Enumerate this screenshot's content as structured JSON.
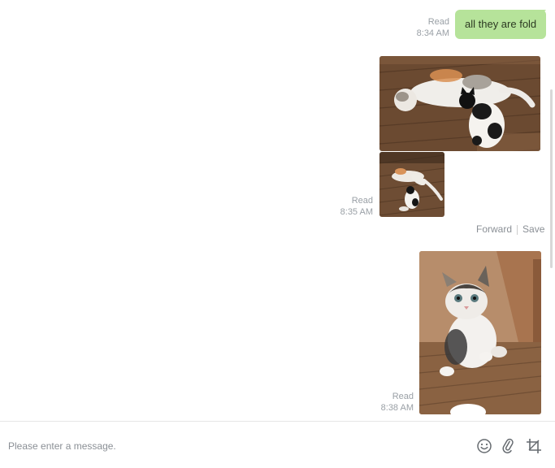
{
  "messages": {
    "text_message": {
      "text": "all they are fold",
      "status": "Read",
      "time": "8:34 AM"
    },
    "photo_group": {
      "status": "Read",
      "time": "8:35 AM",
      "photos": [
        {
          "description": "calico cat lying with black-and-white kitten on wooden floor"
        },
        {
          "description": "cats on wooden floor thumbnail"
        }
      ],
      "actions": {
        "forward_label": "Forward",
        "save_label": "Save"
      }
    },
    "photo_single": {
      "status": "Read",
      "time": "8:38 AM",
      "photos": [
        {
          "description": "white and tabby kitten sitting on wooden floor"
        }
      ]
    }
  },
  "composer": {
    "placeholder": "Please enter a message.",
    "icons": [
      "smiley-icon",
      "paperclip-icon",
      "crop-icon"
    ]
  },
  "colors": {
    "bubble": "#b6e39a",
    "meta_text": "#9aa0a6",
    "icon": "#666b70"
  }
}
